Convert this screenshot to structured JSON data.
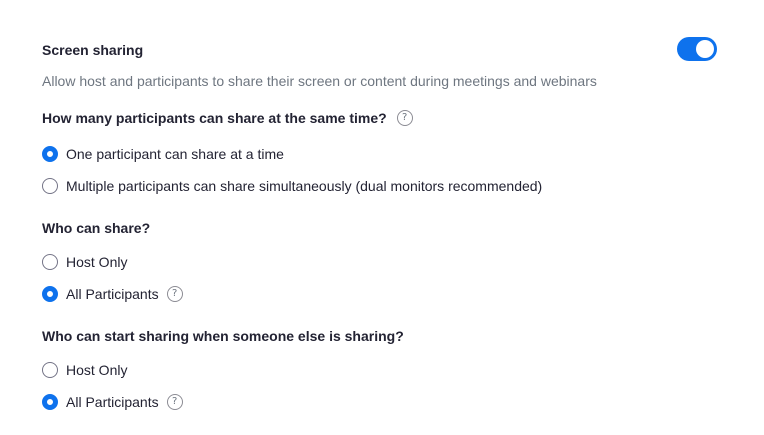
{
  "setting": {
    "title": "Screen sharing",
    "description": "Allow host and participants to share their screen or content during meetings and webinars",
    "enabled": true
  },
  "help_glyph": "?",
  "groups": [
    {
      "question": "How many participants can share at the same time?",
      "has_help": true,
      "options": [
        {
          "label": "One participant can share at a time",
          "selected": true
        },
        {
          "label": "Multiple participants can share simultaneously (dual monitors recommended)",
          "selected": false
        }
      ]
    },
    {
      "question": "Who can share?",
      "options": [
        {
          "label": "Host Only",
          "selected": false
        },
        {
          "label": "All Participants",
          "selected": true,
          "has_help": true
        }
      ]
    },
    {
      "question": "Who can start sharing when someone else is sharing?",
      "options": [
        {
          "label": "Host Only",
          "selected": false
        },
        {
          "label": "All Participants",
          "selected": true,
          "has_help": true
        }
      ]
    }
  ]
}
